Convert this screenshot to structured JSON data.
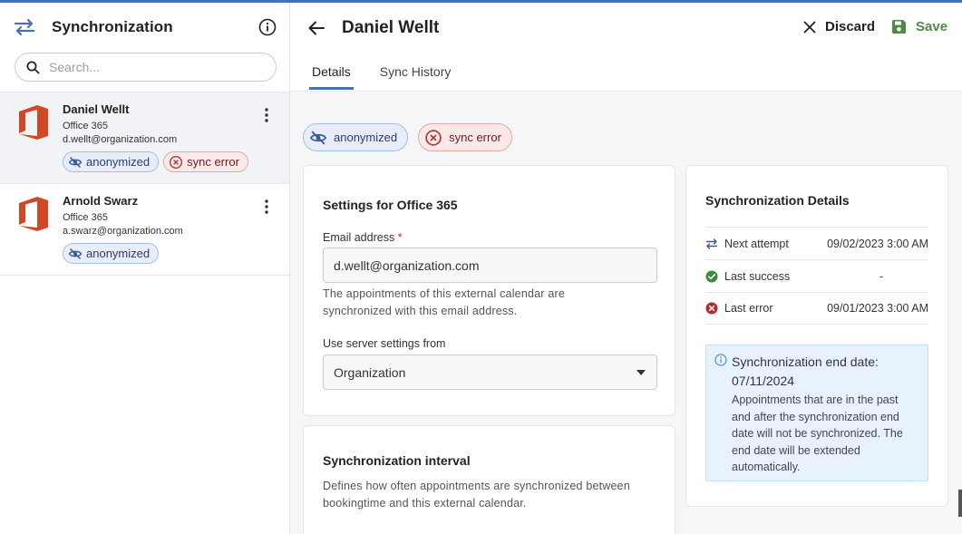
{
  "sidebar": {
    "title": "Synchronization",
    "search_placeholder": "Search...",
    "items": [
      {
        "name": "Daniel Wellt",
        "provider": "Office 365",
        "email": "d.wellt@organization.com",
        "badges": [
          "anonymized",
          "sync error"
        ]
      },
      {
        "name": "Arnold Swarz",
        "provider": "Office 365",
        "email": "a.swarz@organization.com",
        "badges": [
          "anonymized"
        ]
      }
    ]
  },
  "header": {
    "title": "Daniel Wellt",
    "discard_label": "Discard",
    "save_label": "Save",
    "tabs": [
      "Details",
      "Sync History"
    ],
    "active_tab": "Details"
  },
  "status_badges": {
    "anonymized": "anonymized",
    "sync_error": "sync error"
  },
  "settings": {
    "title": "Settings for Office 365",
    "email_label": "Email address",
    "required_mark": "*",
    "email_value": "d.wellt@organization.com",
    "email_helper": "The appointments of this external calendar are synchronized with this email address.",
    "server_label": "Use server settings from",
    "server_value": "Organization"
  },
  "interval": {
    "title": "Synchronization interval",
    "description": "Defines how often appointments are synchronized between bookingtime and this external calendar."
  },
  "details": {
    "title": "Synchronization Details",
    "rows": [
      {
        "label": "Next attempt",
        "value": "09/02/2023 3:00 AM"
      },
      {
        "label": "Last success",
        "value": "-"
      },
      {
        "label": "Last error",
        "value": "09/01/2023 3:00 AM"
      }
    ],
    "notice_title": "Synchronization end date: 07/11/2024",
    "notice_body": "Appointments that are in the past and after the synchronization end date will not be synchronized. The end date will be extended automatically."
  },
  "colors": {
    "accent": "#4a6fb5",
    "save": "#4f8a44",
    "error": "#c0392b",
    "office": "#d24726"
  }
}
